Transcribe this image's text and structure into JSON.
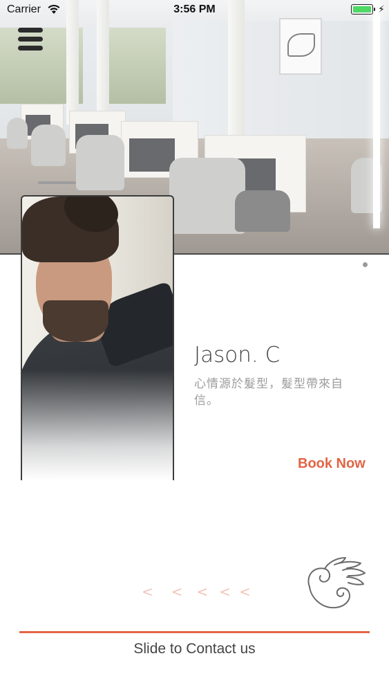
{
  "status_bar": {
    "carrier": "Carrier",
    "time": "3:56 PM",
    "battery_level": 1.0,
    "battery_color": "#4cd964",
    "icons": [
      "wifi-icon",
      "battery-icon",
      "charging-bolt-icon"
    ]
  },
  "header": {
    "menu_icon": "hamburger-menu-icon"
  },
  "carousel": {
    "page_count": 2,
    "active_index": 0
  },
  "stylist": {
    "name": "Jason. C",
    "tagline": "心情源於髮型，髮型帶來自信。",
    "book_label": "Book Now"
  },
  "contact": {
    "hint_arrows": [
      "<",
      "<",
      "<",
      "<",
      "<"
    ],
    "logo_icon": "winged-swirl-logo-icon",
    "slide_label": "Slide to Contact us"
  },
  "colors": {
    "accent": "#e26445",
    "arrow_hint": "#f2c3b7",
    "name_text": "#444444",
    "tagline_text": "#9c9c9c"
  }
}
